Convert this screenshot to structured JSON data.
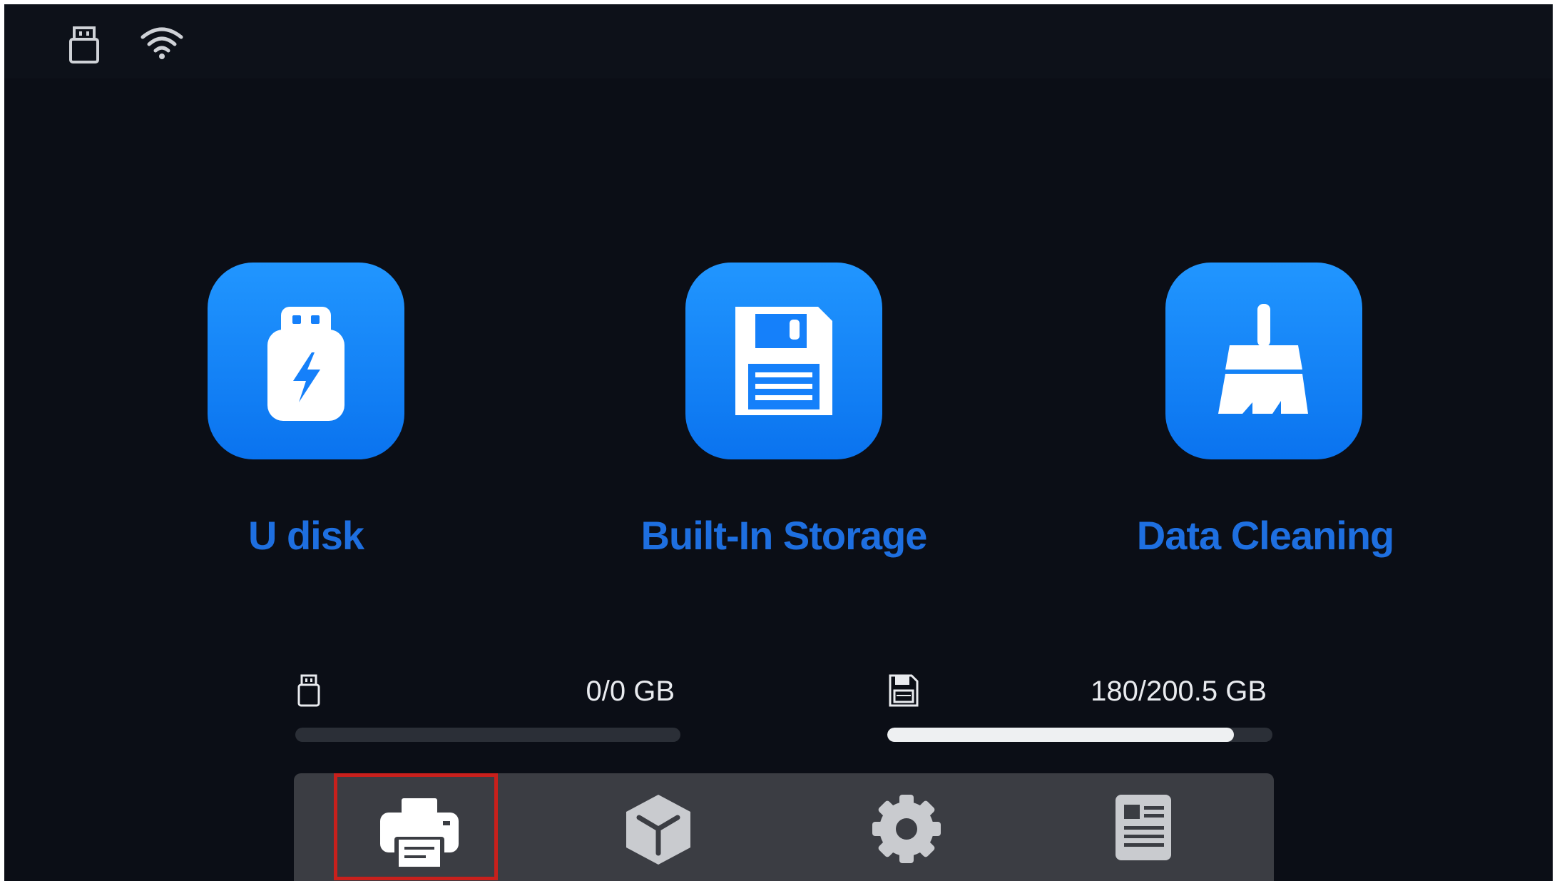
{
  "status_bar": {
    "icons": [
      "usb-icon",
      "wifi-icon"
    ]
  },
  "tiles": [
    {
      "label": "U disk",
      "icon": "usb-drive-icon"
    },
    {
      "label": "Built-In Storage",
      "icon": "floppy-disk-icon"
    },
    {
      "label": "Data Cleaning",
      "icon": "broom-icon"
    }
  ],
  "capacity": {
    "udisk": {
      "icon": "usb-icon",
      "value": "0/0 GB",
      "used_fraction": 0
    },
    "storage": {
      "icon": "floppy-disk-icon",
      "value": "180/200.5 GB",
      "used_fraction": 0.9
    }
  },
  "bottom_nav": {
    "items": [
      {
        "icon": "printer-icon",
        "selected": true
      },
      {
        "icon": "cube-icon",
        "selected": false
      },
      {
        "icon": "gear-icon",
        "selected": false
      },
      {
        "icon": "info-card-icon",
        "selected": false
      }
    ]
  },
  "colors": {
    "background": "#0b0e16",
    "tile_blue": "#1580fa",
    "label_blue": "#1e6fe0",
    "nav_bg": "#3b3d43",
    "selection": "#c8201c",
    "icon_gray": "#c9cbcf"
  }
}
